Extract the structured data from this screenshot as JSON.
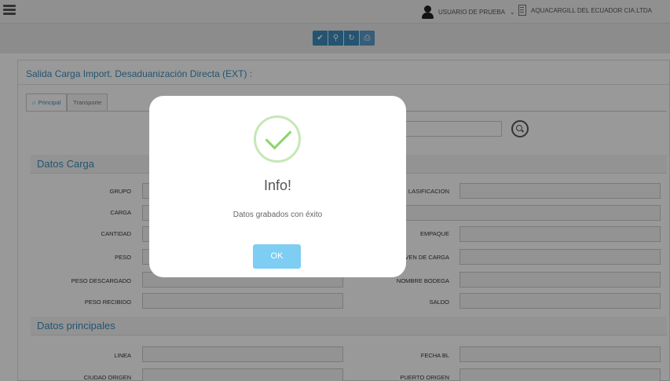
{
  "header": {
    "user_label": "USUARIO DE PRUEBA",
    "user_caret": "⌄",
    "company": "AQUACARGILL DEL ECUADOR CIA.LTDA"
  },
  "toolbar": {
    "buttons": [
      "check-icon",
      "search-icon",
      "refresh-icon",
      "print-icon"
    ]
  },
  "page": {
    "title": "Salida Carga Import. Desaduanización Directa (EXT) :",
    "tabs": [
      "Principal",
      "Transporte"
    ],
    "active_tab": "Principal"
  },
  "sections": {
    "carga": "Datos Carga",
    "principales": "Datos principales"
  },
  "fields_left": [
    "GRUPO",
    "CARGA",
    "CANTIDAD",
    "PESO",
    "PESO DESCARGADO",
    "PESO RECIBIDO",
    "LINEA",
    "CIUDAD ORIGEN"
  ],
  "fields_right": [
    "CLASIFICACION",
    "EMPAQUE",
    "ORIGEN DE CARGA",
    "NOMBRE BODEGA",
    "SALDO",
    "FECHA BL",
    "PUERTO ORIGEN"
  ],
  "fields_right_visible": [
    "LASIFICACION",
    "EMPAQUE",
    "VEN DE CARGA",
    "NOMBRE BODEGA",
    "SALDO",
    "FECHA BL",
    "PUERTO ORIGEN"
  ],
  "modal": {
    "title": "Info!",
    "message": "Datos grabados con éxito",
    "button": "OK"
  },
  "colors": {
    "accent": "#3c8dbc",
    "ok_button": "#7ecdf3",
    "success": "#8cd46b"
  }
}
